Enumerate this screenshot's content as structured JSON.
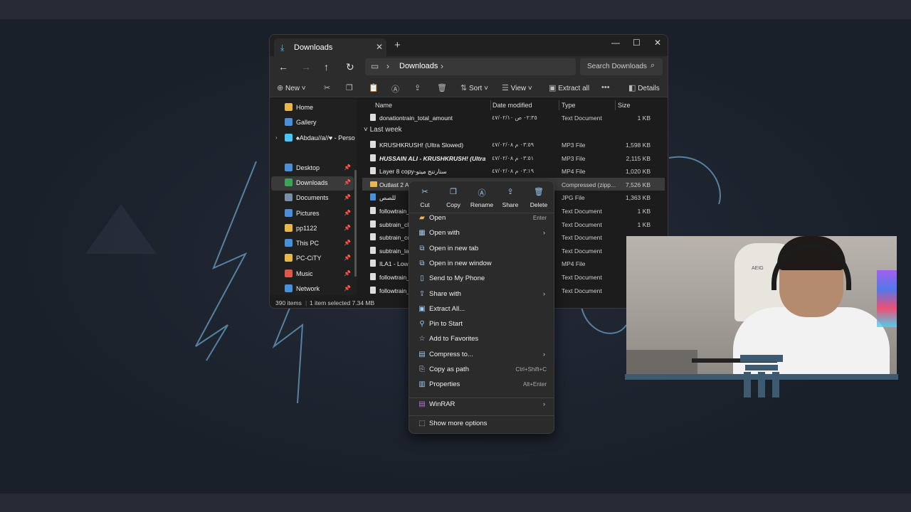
{
  "explorer": {
    "tab_title": "Downloads",
    "address": "Downloads",
    "search_placeholder": "Search Downloads",
    "commands": {
      "new": "New",
      "sort": "Sort",
      "view": "View",
      "extract_all": "Extract all",
      "details": "Details"
    },
    "sidebar": [
      {
        "label": "Home",
        "icon": "home-icon",
        "color": "#e8b84a",
        "pinned": false
      },
      {
        "label": "Gallery",
        "icon": "gallery-icon",
        "color": "#4a90d9",
        "pinned": false
      },
      {
        "label": "♠Abdau//a//♥ - Perso",
        "icon": "onedrive-icon",
        "color": "#4cc2ff",
        "pinned": false
      },
      {
        "label": "Desktop",
        "icon": "desktop-icon",
        "color": "#4a90d9",
        "pinned": true
      },
      {
        "label": "Downloads",
        "icon": "downloads-icon",
        "color": "#3da35a",
        "pinned": true
      },
      {
        "label": "Documents",
        "icon": "documents-icon",
        "color": "#7a8fa6",
        "pinned": true
      },
      {
        "label": "Pictures",
        "icon": "pictures-icon",
        "color": "#4a90d9",
        "pinned": true
      },
      {
        "label": "pp1122",
        "icon": "folder-icon",
        "color": "#e8b84a",
        "pinned": true
      },
      {
        "label": "This PC",
        "icon": "pc-icon",
        "color": "#4a90d9",
        "pinned": true
      },
      {
        "label": "PC-CiTY",
        "icon": "folder-icon",
        "color": "#e8b84a",
        "pinned": true
      },
      {
        "label": "Music",
        "icon": "music-icon",
        "color": "#e0584a",
        "pinned": true
      },
      {
        "label": "Network",
        "icon": "network-icon",
        "color": "#4a90d9",
        "pinned": true
      }
    ],
    "columns": {
      "name": "Name",
      "date": "Date modified",
      "type": "Type",
      "size": "Size"
    },
    "first_row": {
      "name": "donationtrain_total_amount",
      "date": "٠٢:٣٥ ص ٤٧/٠٢/١٠",
      "type": "Text Document",
      "size": "1 KB"
    },
    "group_label": "Last week",
    "rows": [
      {
        "name": "KRUSHKRUSH! (Ultra Slowed)",
        "date": "٠٣:٥٩ م ٤٧/٠٢/٠٨",
        "type": "MP3 File",
        "size": "1,598 KB"
      },
      {
        "name": "HUSSAIN ALI - KRUSHKRUSH! (Ultra S...",
        "date": "٠٣:٥١ م ٤٧/٠٢/٠٨",
        "type": "MP3 File",
        "size": "2,115 KB"
      },
      {
        "name": "Layer 8 copy-ستارتنج ميتو",
        "date": "٠٣:١٩ م ٤٧/٠٢/٠٨",
        "type": "MP4 File",
        "size": "1,020 KB"
      },
      {
        "name": "Outlast 2 Arc...",
        "date": "",
        "type": "Compressed (zipp...",
        "size": "7,526 KB"
      },
      {
        "name": "للصص",
        "date": "",
        "type": "JPG File",
        "size": "1,363 KB"
      },
      {
        "name": "followtrain_",
        "date": "",
        "type": "Text Document",
        "size": "1 KB"
      },
      {
        "name": "subtrain_clo",
        "date": "",
        "type": "Text Document",
        "size": "1 KB"
      },
      {
        "name": "subtrain_co",
        "date": "",
        "type": "Text Document",
        "size": ""
      },
      {
        "name": "subtrain_late",
        "date": "",
        "type": "Text Document",
        "size": ""
      },
      {
        "name": "ILA1 - Low F",
        "date": "",
        "type": "MP4 File",
        "size": ""
      },
      {
        "name": "followtrain_",
        "date": "",
        "type": "Text Document",
        "size": ""
      },
      {
        "name": "followtrain_",
        "date": "",
        "type": "Text Document",
        "size": ""
      }
    ],
    "status": {
      "count": "390 items",
      "selected": "1 item selected  7.34 MB"
    }
  },
  "context_menu": {
    "quick_actions": [
      {
        "label": "Cut",
        "icon": "scissors-icon"
      },
      {
        "label": "Copy",
        "icon": "copy-icon"
      },
      {
        "label": "Rename",
        "icon": "rename-icon"
      },
      {
        "label": "Share",
        "icon": "share-icon"
      },
      {
        "label": "Delete",
        "icon": "trash-icon"
      }
    ],
    "items": [
      {
        "label": "Open",
        "shortcut": "Enter",
        "submenu": false,
        "icon": "folder-open-icon"
      },
      {
        "label": "Open with",
        "shortcut": "",
        "submenu": true,
        "icon": "open-with-icon"
      },
      {
        "label": "Open in new tab",
        "shortcut": "",
        "submenu": false,
        "icon": "new-tab-icon"
      },
      {
        "label": "Open in new window",
        "shortcut": "",
        "submenu": false,
        "icon": "new-window-icon"
      },
      {
        "label": "Send to My Phone",
        "shortcut": "",
        "submenu": false,
        "icon": "phone-icon"
      },
      {
        "label": "Share with",
        "shortcut": "",
        "submenu": true,
        "icon": "share-with-icon"
      },
      {
        "label": "Extract All...",
        "shortcut": "",
        "submenu": false,
        "icon": "extract-icon"
      },
      {
        "label": "Pin to Start",
        "shortcut": "",
        "submenu": false,
        "icon": "pin-icon"
      },
      {
        "label": "Add to Favorites",
        "shortcut": "",
        "submenu": false,
        "icon": "star-icon"
      },
      {
        "label": "Compress to...",
        "shortcut": "",
        "submenu": true,
        "icon": "compress-icon"
      },
      {
        "label": "Copy as path",
        "shortcut": "Ctrl+Shift+C",
        "submenu": false,
        "icon": "path-icon"
      },
      {
        "label": "Properties",
        "shortcut": "Alt+Enter",
        "submenu": false,
        "icon": "properties-icon"
      }
    ],
    "winrar": "WinRAR",
    "more": "Show more options"
  },
  "webcam": {
    "chair_logo": "AEIG"
  }
}
